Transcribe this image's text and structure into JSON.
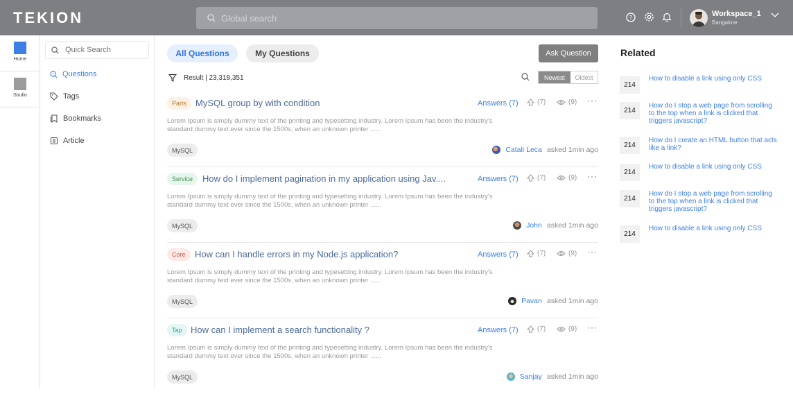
{
  "header": {
    "logo": "TEKION",
    "search_placeholder": "Global search",
    "workspace_name": "Workspace_1",
    "workspace_location": "Bangalore"
  },
  "rail": [
    {
      "label": "Home",
      "color": "#3d7fe6"
    },
    {
      "label": "Studio",
      "color": "#9b9b9b"
    }
  ],
  "sidenav": {
    "search_placeholder": "Quick Search",
    "items": [
      "Questions",
      "Tags",
      "Bookmarks",
      "Article"
    ]
  },
  "main": {
    "tabs": [
      "All Questions",
      "My Questions"
    ],
    "ask_button": "Ask Question",
    "result_text": "Result | 23,318,351",
    "sort_options": [
      "Newest",
      "Oldest"
    ],
    "questions": [
      {
        "category": "Parts",
        "title": "MySQL group by with condition",
        "answers": "Answers (7)",
        "votes": "(7)",
        "views": "(9)",
        "excerpt": "Lorem Ipsum is simply dummy text of the printing and typesetting industry. Lorem Ipsum has been the industry's standard dummy text ever since the 1500s, when an unknown printer ......",
        "tag": "MySQL",
        "user": "Catali Leca",
        "asked": "asked 1min ago"
      },
      {
        "category": "Service",
        "title": "How do I implement pagination in my  application using Jav....",
        "answers": "Answers (7)",
        "votes": "(7)",
        "views": "(9)",
        "excerpt": "Lorem Ipsum is simply dummy text of the printing and typesetting industry. Lorem Ipsum has been the industry's standard dummy text ever since the 1500s, when an unknown printer ......",
        "tag": "MySQL",
        "user": "John",
        "asked": "asked 1min ago"
      },
      {
        "category": "Core",
        "title": "How can I handle errors in my Node.js application?",
        "answers": "Answers (7)",
        "votes": "(7)",
        "views": "(9)",
        "excerpt": "Lorem Ipsum is simply dummy text of the printing and typesetting industry. Lorem Ipsum has been the industry's standard dummy text ever since the 1500s, when an unknown printer ......",
        "tag": "MySQL",
        "user": "Pavan",
        "asked": "asked 1min ago"
      },
      {
        "category": "Tap",
        "title": "How can I implement a search functionality ?",
        "answers": "Answers (7)",
        "votes": "(7)",
        "views": "(9)",
        "excerpt": "Lorem Ipsum is simply dummy text of the printing and typesetting industry. Lorem Ipsum has been the industry's standard dummy text ever since the 1500s, when an unknown printer ......",
        "tag": "MySQL",
        "user": "Sanjay",
        "asked": "asked 1min ago"
      }
    ]
  },
  "related": {
    "title": "Related",
    "items": [
      {
        "count": "214",
        "text": "How to disable a link using only CSS"
      },
      {
        "count": "214",
        "text": "How do I stop a web page from scrolling to the top when a link is clicked that triggers javascript?"
      },
      {
        "count": "214",
        "text": "How do I create an HTML button that acts like a link?"
      },
      {
        "count": "214",
        "text": "How to disable a link using only CSS"
      },
      {
        "count": "214",
        "text": "How do I stop a web page from scrolling to the top when a link is clicked that triggers javascript?"
      },
      {
        "count": "214",
        "text": "How to disable a link using only CSS"
      }
    ]
  },
  "colors": {
    "accent": "#3d7fe6",
    "header_bg": "#7d7f83",
    "tag_parts": "#fdf1e4",
    "tag_service": "#e7f6ec",
    "tag_core": "#fde9e6",
    "tag_tap": "#e2f6f4"
  }
}
